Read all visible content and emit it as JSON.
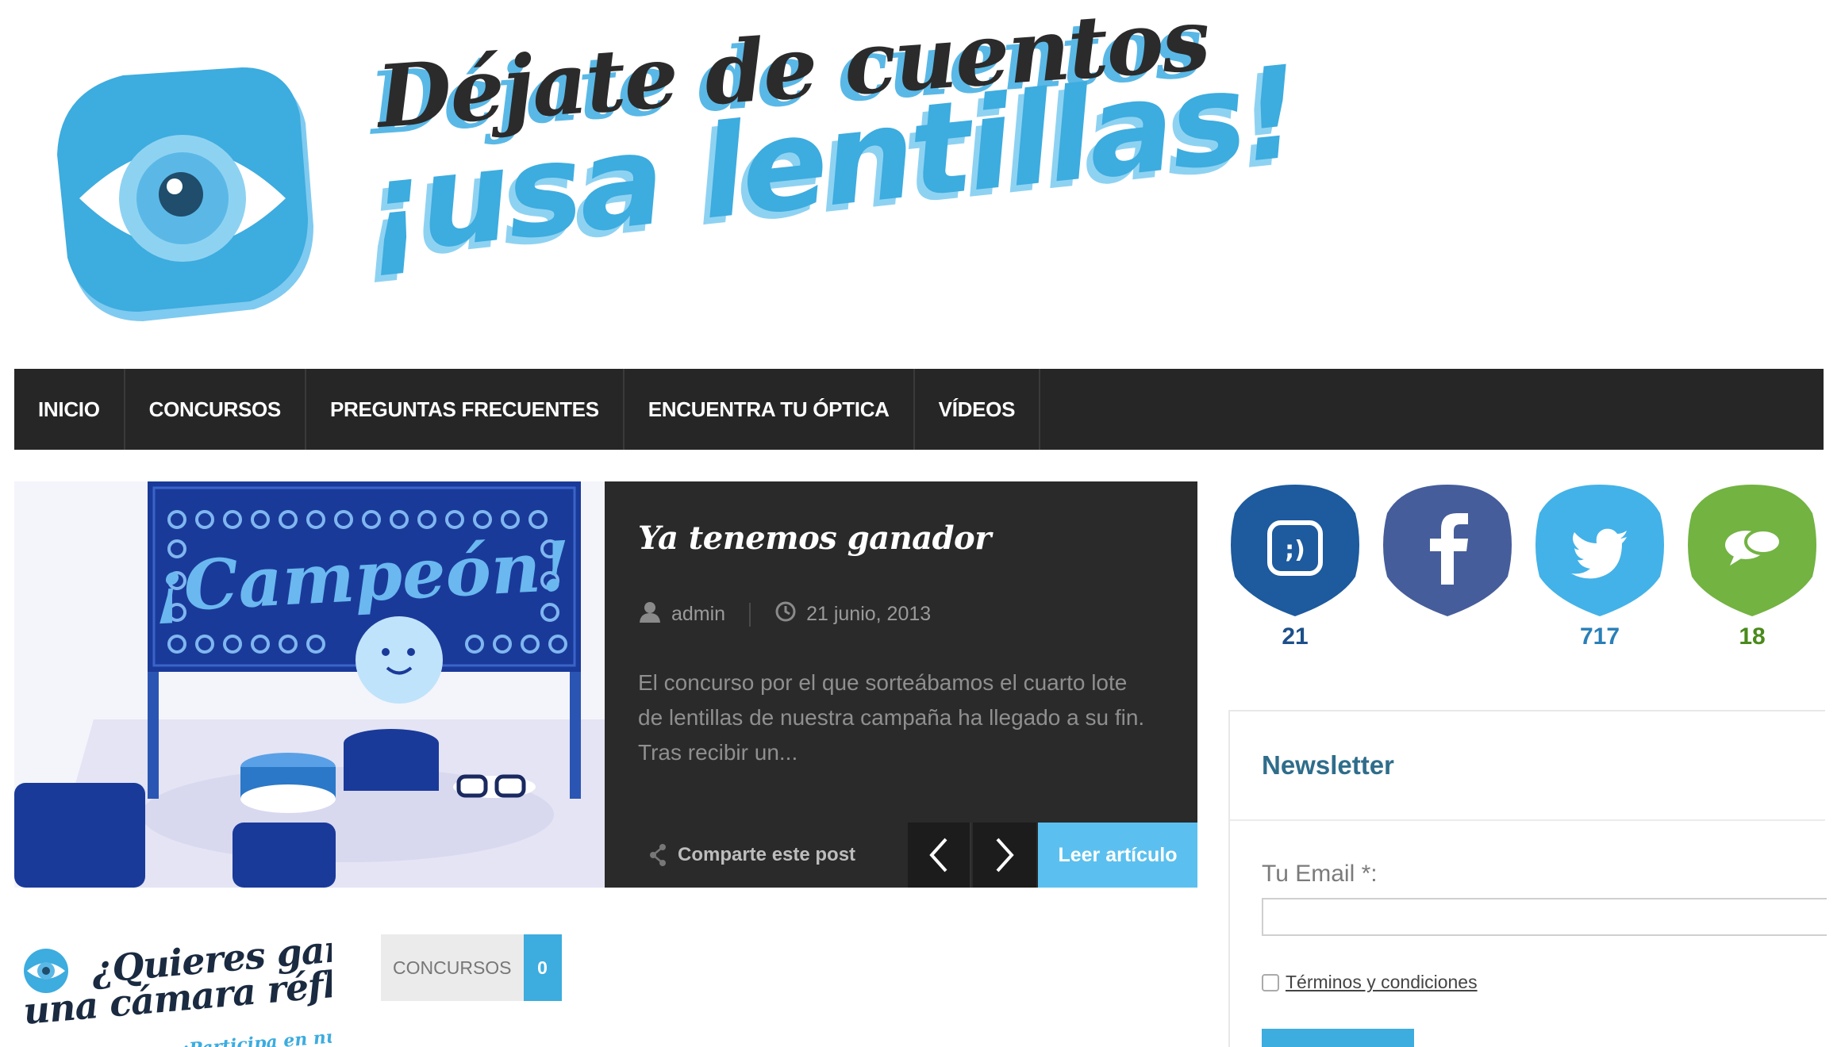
{
  "header": {
    "logo_line1": "Déjate de cuentos",
    "logo_line2": "¡usa lentillas!"
  },
  "nav": {
    "items": [
      {
        "label": "INICIO"
      },
      {
        "label": "CONCURSOS"
      },
      {
        "label": "PREGUNTAS FRECUENTES"
      },
      {
        "label": "ENCUENTRA TU ÓPTICA"
      },
      {
        "label": "VÍDEOS"
      }
    ]
  },
  "featured": {
    "image_text": "¡Campeón!",
    "title": "Ya tenemos ganador",
    "author": "admin",
    "date": "21 junio, 2013",
    "excerpt": "El concurso por el que sorteábamos el cuarto lote de lentillas de nuestra campaña ha llegado a su fin. Tras recibir un...",
    "share_label": "Comparte este post",
    "read_label": "Leer artículo",
    "icons": {
      "author": "user-icon",
      "date": "clock-icon",
      "share": "share-icon",
      "prev": "chevron-left-icon",
      "next": "chevron-right-icon"
    }
  },
  "social": [
    {
      "network": "tuenti",
      "icon": "tuenti-icon",
      "count": "21",
      "color": "#1d5a9e",
      "count_color": "#1d4f8a"
    },
    {
      "network": "facebook",
      "icon": "facebook-icon",
      "count": "",
      "color": "#465d9b",
      "count_color": "#3b5998"
    },
    {
      "network": "twitter",
      "icon": "twitter-icon",
      "count": "717",
      "color": "#43b2e8",
      "count_color": "#2a7fb8"
    },
    {
      "network": "comments",
      "icon": "comments-icon",
      "count": "18",
      "color": "#72b342",
      "count_color": "#4a8a1c"
    }
  ],
  "newsletter": {
    "title": "Newsletter",
    "email_label": "Tu Email *:",
    "email_value": "",
    "terms_label": "Términos y condiciones"
  },
  "post": {
    "thumb_line1": "¿Quieres ganar",
    "thumb_line2": "una cámara réflex?",
    "thumb_line3": "¡Participa en nuestro concurso!",
    "category": "CONCURSOS",
    "comments": "0"
  }
}
